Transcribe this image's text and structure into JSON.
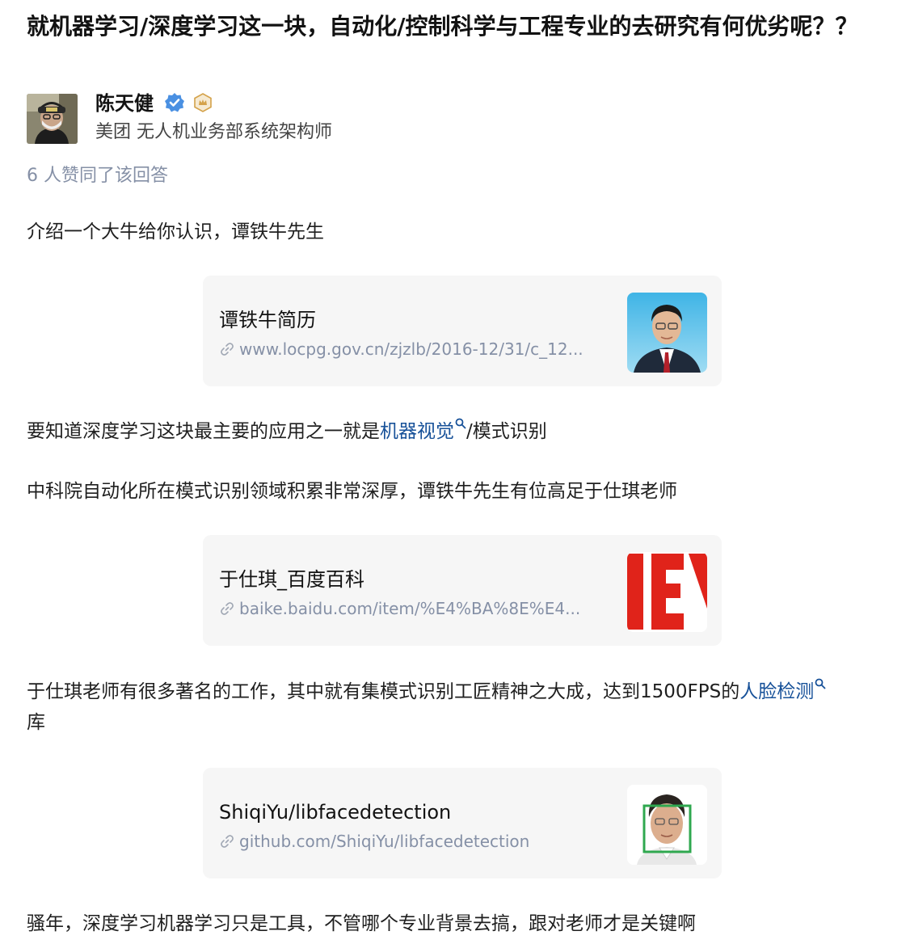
{
  "question": {
    "title": "就机器学习/深度学习这一块，自动化/控制科学与工程专业的去研究有何优劣呢？？"
  },
  "author": {
    "name": "陈天健",
    "bio": "美团 无人机业务部系统架构师",
    "icons": [
      "avatar",
      "verified-badge-icon",
      "medal-icon"
    ],
    "colors": {
      "verified": "#4a90e2",
      "medal": "#d4a24a"
    }
  },
  "vote_info": "6 人赞同了该回答",
  "content": {
    "p1": "介绍一个大牛给你认识，谭铁牛先生",
    "card1": {
      "title": "谭铁牛简历",
      "url": "www.locpg.gov.cn/zjzlb/2016-12/31/c_12...",
      "thumb": "portrait-photo"
    },
    "p2": {
      "before": "要知道深度学习这块最主要的应用之一就是",
      "keyword": "机器视觉",
      "after": "/模式识别"
    },
    "p3": "中科院自动化所在模式识别领域积累非常深厚，谭铁牛先生有位高足于仕琪老师",
    "card2": {
      "title": "于仕琪_百度百科",
      "url": "baike.baidu.com/item/%E4%BA%8E%E4...",
      "thumb": "baike-logo"
    },
    "p4": {
      "before": "于仕琪老师有很多著名的工作，其中就有集模式识别工匠精神之大成，达到1500FPS的",
      "keyword": "人脸检测",
      "after": "库"
    },
    "card3": {
      "title": "ShiqiYu/libfacedetection",
      "url": "github.com/ShiqiYu/libfacedetection",
      "thumb": "face-detection-photo"
    },
    "p5": "骚年，深度学习机器学习只是工具，不管哪个专业背景去搞，跟对老师才是关键啊"
  },
  "colors": {
    "link": "#175199",
    "muted": "#8590a6",
    "card_bg": "#f6f6f6"
  }
}
